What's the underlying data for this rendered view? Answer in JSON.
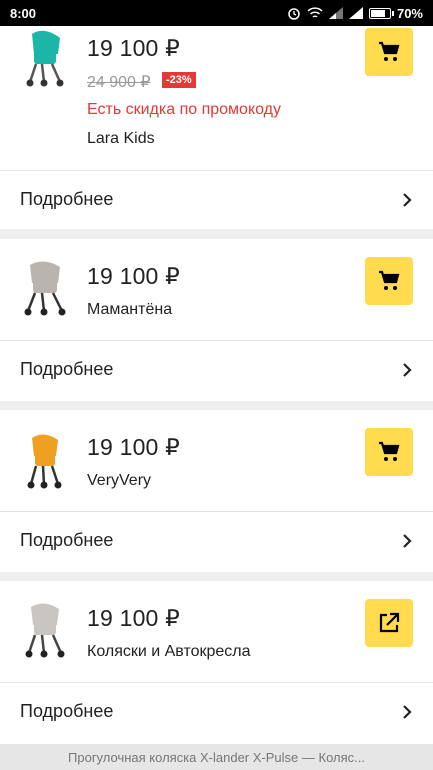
{
  "status_bar": {
    "time": "8:00",
    "battery": "70%"
  },
  "offers": [
    {
      "price": "19 100 ₽",
      "old_price": "24 900 ₽",
      "discount": "-23%",
      "promo": "Есть скидка по промокоду",
      "shop": "Lara Kids",
      "action_icon": "cart-icon",
      "more_label": "Подробнее",
      "stroller_color": "#1bb6a8"
    },
    {
      "price": "19 100 ₽",
      "shop": "Мамантёна",
      "action_icon": "cart-icon",
      "more_label": "Подробнее",
      "stroller_color": "#b9b4ad"
    },
    {
      "price": "19 100 ₽",
      "shop": "VeryVery",
      "action_icon": "cart-icon",
      "more_label": "Подробнее",
      "stroller_color": "#f0a020"
    },
    {
      "price": "19 100 ₽",
      "shop": "Коляски и Автокресла",
      "action_icon": "external-link-icon",
      "more_label": "Подробнее",
      "stroller_color": "#c9c6c2"
    }
  ],
  "footer": {
    "title": "Прогулочная коляска X-lander X-Pulse — Коляс..."
  },
  "colors": {
    "accent_button": "#ffdb4d",
    "promo_red": "#e53935"
  }
}
